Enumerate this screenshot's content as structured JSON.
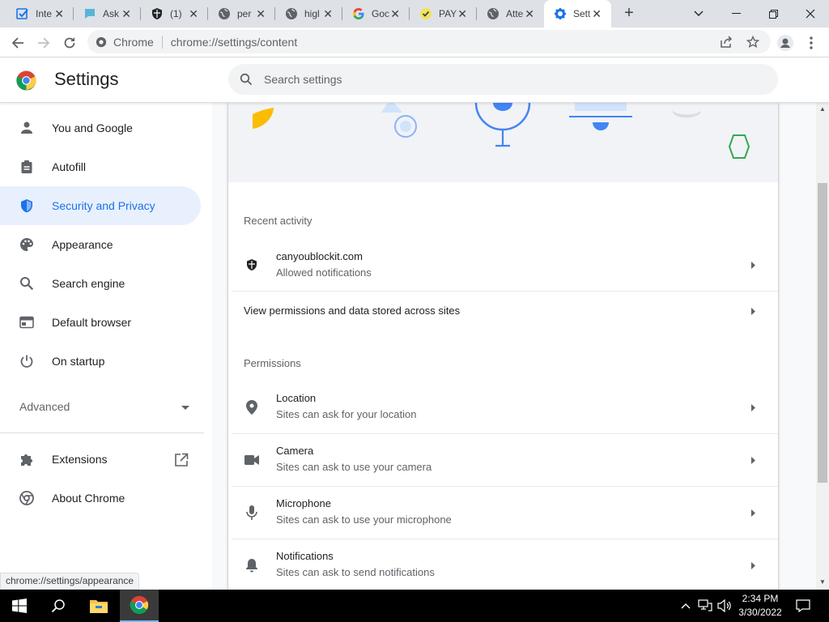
{
  "browser": {
    "tabs": [
      {
        "title": "Inte",
        "icon": "checkbox-icon"
      },
      {
        "title": "Ask",
        "icon": "ask-icon"
      },
      {
        "title": "(1)",
        "icon": "shield-icon"
      },
      {
        "title": "per",
        "icon": "globe-icon"
      },
      {
        "title": "higl",
        "icon": "globe-icon"
      },
      {
        "title": "Goc",
        "icon": "google-icon"
      },
      {
        "title": "PAY",
        "icon": "check-badge-icon"
      },
      {
        "title": "Atte",
        "icon": "globe-icon"
      },
      {
        "title": "Sett",
        "icon": "gear-icon",
        "active": true
      }
    ],
    "omnibox": {
      "chip": "Chrome",
      "url": "chrome://settings/content"
    },
    "status_url": "chrome://settings/appearance"
  },
  "settings": {
    "title": "Settings",
    "search_placeholder": "Search settings",
    "nav": [
      {
        "label": "You and Google",
        "icon": "person-icon"
      },
      {
        "label": "Autofill",
        "icon": "clipboard-icon"
      },
      {
        "label": "Security and Privacy",
        "icon": "shield-icon",
        "selected": true
      },
      {
        "label": "Appearance",
        "icon": "palette-icon"
      },
      {
        "label": "Search engine",
        "icon": "search-icon"
      },
      {
        "label": "Default browser",
        "icon": "browser-icon"
      },
      {
        "label": "On startup",
        "icon": "power-icon"
      }
    ],
    "advanced_label": "Advanced",
    "extensions_label": "Extensions",
    "about_label": "About Chrome"
  },
  "content": {
    "recent_activity_heading": "Recent activity",
    "recent_site": {
      "title": "canyoublockit.com",
      "subtitle": "Allowed notifications"
    },
    "view_permissions_label": "View permissions and data stored across sites",
    "permissions_heading": "Permissions",
    "permissions": [
      {
        "title": "Location",
        "subtitle": "Sites can ask for your location",
        "icon": "location-pin-icon"
      },
      {
        "title": "Camera",
        "subtitle": "Sites can ask to use your camera",
        "icon": "camera-icon"
      },
      {
        "title": "Microphone",
        "subtitle": "Sites can ask to use your microphone",
        "icon": "microphone-icon"
      },
      {
        "title": "Notifications",
        "subtitle": "Sites can ask to send notifications",
        "icon": "bell-icon"
      }
    ]
  },
  "taskbar": {
    "time": "2:34 PM",
    "date": "3/30/2022"
  },
  "colors": {
    "accent": "#1a73e8",
    "selected_bg": "#e8f0fe",
    "taskbar": "#000000"
  }
}
